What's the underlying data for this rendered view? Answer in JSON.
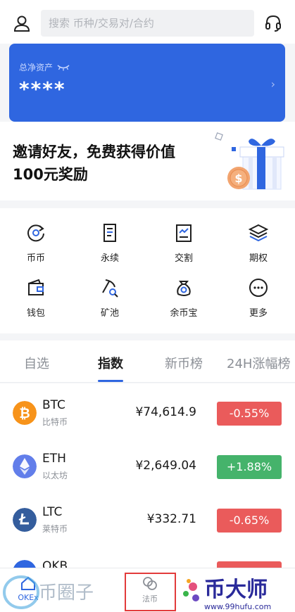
{
  "search": {
    "placeholder": "搜索 币种/交易对/合约"
  },
  "asset": {
    "label": "总净资产",
    "value": "****"
  },
  "invite": {
    "text": "邀请好友，免费获得价值100元奖励",
    "coin_symbol": "$"
  },
  "grid": [
    {
      "label": "币币",
      "icon": "spot-icon"
    },
    {
      "label": "永续",
      "icon": "perpetual-icon"
    },
    {
      "label": "交割",
      "icon": "futures-icon"
    },
    {
      "label": "期权",
      "icon": "options-icon"
    },
    {
      "label": "钱包",
      "icon": "wallet-icon"
    },
    {
      "label": "矿池",
      "icon": "pool-icon"
    },
    {
      "label": "余币宝",
      "icon": "earn-icon"
    },
    {
      "label": "更多",
      "icon": "more-icon"
    }
  ],
  "tabs": [
    "自选",
    "指数",
    "新币榜",
    "24H涨幅榜"
  ],
  "active_tab": "指数",
  "coins": [
    {
      "symbol": "BTC",
      "name": "比特币",
      "price": "¥74,614.9",
      "change": "-0.55%",
      "color": "#f7931a",
      "change_color": "#ea5b5b"
    },
    {
      "symbol": "ETH",
      "name": "以太坊",
      "price": "¥2,649.04",
      "change": "+1.88%",
      "color": "#627eea",
      "change_color": "#45b36b"
    },
    {
      "symbol": "LTC",
      "name": "莱特币",
      "price": "¥332.71",
      "change": "-0.65%",
      "color": "#345d9d",
      "change_color": "#ea5b5b"
    },
    {
      "symbol": "OKB",
      "change_color": "#ea5b5b"
    }
  ],
  "bottom": {
    "okex_label": "OKEx",
    "fabi_label": "法币"
  },
  "watermark": {
    "left_text": "币圈子",
    "right_text": "币大师",
    "right_url": "www.99hufu.com"
  },
  "colors": {
    "accent": "#2f66e0",
    "down": "#ea5b5b",
    "up": "#45b36b"
  }
}
